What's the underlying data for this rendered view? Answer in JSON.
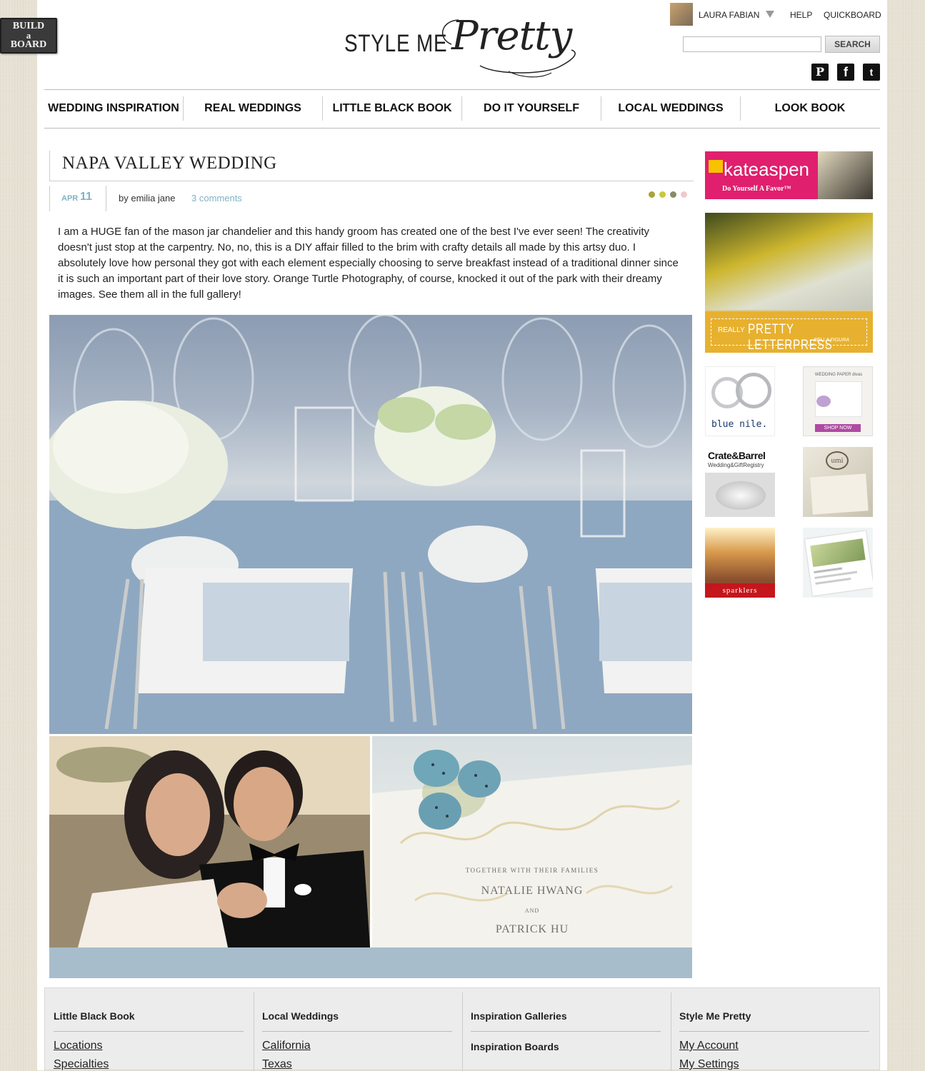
{
  "build_board": {
    "line1": "BUILD",
    "line2": "a",
    "line3": "BOARD"
  },
  "logo": {
    "part1": "STYLE ME",
    "part2": "Pretty"
  },
  "user": {
    "name": "LAURA FABIAN",
    "help": "HELP",
    "quickboard": "QUICKBOARD"
  },
  "search": {
    "button": "SEARCH",
    "placeholder": ""
  },
  "social": {
    "pinterest": "P",
    "facebook": "f",
    "twitter": "t"
  },
  "nav": [
    "WEDDING INSPIRATION",
    "REAL WEDDINGS",
    "LITTLE BLACK BOOK",
    "DO IT YOURSELF",
    "LOCAL WEDDINGS",
    "LOOK BOOK"
  ],
  "post": {
    "title": "NAPA VALLEY WEDDING",
    "month": "APR",
    "day": "11",
    "author": "by emilia jane",
    "comments": "3 comments",
    "body": "I am a HUGE fan of the mason jar chandelier and this handy groom has created one of the best I've ever seen! The creativity doesn't just stop at the carpentry. No, no, this is a DIY affair filled to the brim with crafty details all made by this artsy duo. I absolutely love how personal they got with each element especially choosing to serve breakfast instead of a traditional dinner since it is such an important part of their love story. Orange Turtle Photography, of course, knocked it out of the park with their dreamy images. See them all in the full gallery!",
    "dot_colors": [
      "#a8a43a",
      "#c8c83a",
      "#8a8a6a",
      "#f2c8c8"
    ]
  },
  "invite": {
    "line1": "TOGETHER WITH THEIR FAMILIES",
    "line2": "NATALIE HWANG",
    "line3": "AND",
    "line4": "PATRICK HU"
  },
  "ads": {
    "kate": {
      "brand": "kateaspen",
      "tagline": "Do Yourself A Favor™"
    },
    "letterpress": {
      "prefix": "REALLY",
      "title": "PRETTY LETTERPRESS",
      "sub": "BELLA FIGURA"
    },
    "bluenile": "blue nile.",
    "weddingpaper": {
      "title": "WEDDING PAPER divas",
      "cta": "SHOP NOW"
    },
    "crate": {
      "title": "Crate&Barrel",
      "sub": "Wedding&GiftRegistry"
    },
    "umi": "umi",
    "sparklers": "sparklers"
  },
  "footer": [
    {
      "heading": "Little Black Book",
      "links": [
        "Locations",
        "Specialties"
      ]
    },
    {
      "heading": "Local Weddings",
      "links": [
        "California",
        "Texas"
      ]
    },
    {
      "heading": "Inspiration Galleries",
      "links": [
        "Inspiration Boards"
      ]
    },
    {
      "heading": "Style Me Pretty",
      "links": [
        "My Account",
        "My Settings"
      ]
    }
  ]
}
